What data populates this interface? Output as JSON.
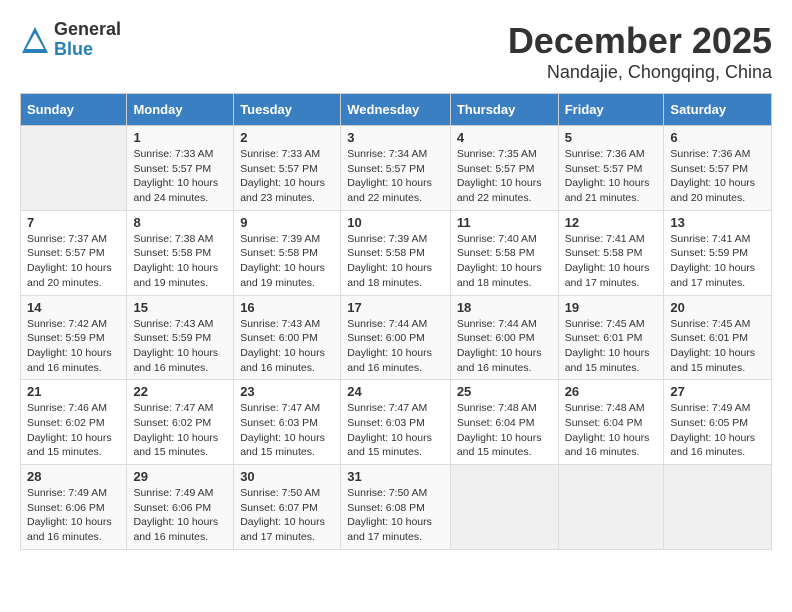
{
  "logo": {
    "general": "General",
    "blue": "Blue"
  },
  "title": "December 2025",
  "location": "Nandajie, Chongqing, China",
  "headers": [
    "Sunday",
    "Monday",
    "Tuesday",
    "Wednesday",
    "Thursday",
    "Friday",
    "Saturday"
  ],
  "weeks": [
    [
      {
        "day": "",
        "info": ""
      },
      {
        "day": "1",
        "info": "Sunrise: 7:33 AM\nSunset: 5:57 PM\nDaylight: 10 hours\nand 24 minutes."
      },
      {
        "day": "2",
        "info": "Sunrise: 7:33 AM\nSunset: 5:57 PM\nDaylight: 10 hours\nand 23 minutes."
      },
      {
        "day": "3",
        "info": "Sunrise: 7:34 AM\nSunset: 5:57 PM\nDaylight: 10 hours\nand 22 minutes."
      },
      {
        "day": "4",
        "info": "Sunrise: 7:35 AM\nSunset: 5:57 PM\nDaylight: 10 hours\nand 22 minutes."
      },
      {
        "day": "5",
        "info": "Sunrise: 7:36 AM\nSunset: 5:57 PM\nDaylight: 10 hours\nand 21 minutes."
      },
      {
        "day": "6",
        "info": "Sunrise: 7:36 AM\nSunset: 5:57 PM\nDaylight: 10 hours\nand 20 minutes."
      }
    ],
    [
      {
        "day": "7",
        "info": "Sunrise: 7:37 AM\nSunset: 5:57 PM\nDaylight: 10 hours\nand 20 minutes."
      },
      {
        "day": "8",
        "info": "Sunrise: 7:38 AM\nSunset: 5:58 PM\nDaylight: 10 hours\nand 19 minutes."
      },
      {
        "day": "9",
        "info": "Sunrise: 7:39 AM\nSunset: 5:58 PM\nDaylight: 10 hours\nand 19 minutes."
      },
      {
        "day": "10",
        "info": "Sunrise: 7:39 AM\nSunset: 5:58 PM\nDaylight: 10 hours\nand 18 minutes."
      },
      {
        "day": "11",
        "info": "Sunrise: 7:40 AM\nSunset: 5:58 PM\nDaylight: 10 hours\nand 18 minutes."
      },
      {
        "day": "12",
        "info": "Sunrise: 7:41 AM\nSunset: 5:58 PM\nDaylight: 10 hours\nand 17 minutes."
      },
      {
        "day": "13",
        "info": "Sunrise: 7:41 AM\nSunset: 5:59 PM\nDaylight: 10 hours\nand 17 minutes."
      }
    ],
    [
      {
        "day": "14",
        "info": "Sunrise: 7:42 AM\nSunset: 5:59 PM\nDaylight: 10 hours\nand 16 minutes."
      },
      {
        "day": "15",
        "info": "Sunrise: 7:43 AM\nSunset: 5:59 PM\nDaylight: 10 hours\nand 16 minutes."
      },
      {
        "day": "16",
        "info": "Sunrise: 7:43 AM\nSunset: 6:00 PM\nDaylight: 10 hours\nand 16 minutes."
      },
      {
        "day": "17",
        "info": "Sunrise: 7:44 AM\nSunset: 6:00 PM\nDaylight: 10 hours\nand 16 minutes."
      },
      {
        "day": "18",
        "info": "Sunrise: 7:44 AM\nSunset: 6:00 PM\nDaylight: 10 hours\nand 16 minutes."
      },
      {
        "day": "19",
        "info": "Sunrise: 7:45 AM\nSunset: 6:01 PM\nDaylight: 10 hours\nand 15 minutes."
      },
      {
        "day": "20",
        "info": "Sunrise: 7:45 AM\nSunset: 6:01 PM\nDaylight: 10 hours\nand 15 minutes."
      }
    ],
    [
      {
        "day": "21",
        "info": "Sunrise: 7:46 AM\nSunset: 6:02 PM\nDaylight: 10 hours\nand 15 minutes."
      },
      {
        "day": "22",
        "info": "Sunrise: 7:47 AM\nSunset: 6:02 PM\nDaylight: 10 hours\nand 15 minutes."
      },
      {
        "day": "23",
        "info": "Sunrise: 7:47 AM\nSunset: 6:03 PM\nDaylight: 10 hours\nand 15 minutes."
      },
      {
        "day": "24",
        "info": "Sunrise: 7:47 AM\nSunset: 6:03 PM\nDaylight: 10 hours\nand 15 minutes."
      },
      {
        "day": "25",
        "info": "Sunrise: 7:48 AM\nSunset: 6:04 PM\nDaylight: 10 hours\nand 15 minutes."
      },
      {
        "day": "26",
        "info": "Sunrise: 7:48 AM\nSunset: 6:04 PM\nDaylight: 10 hours\nand 16 minutes."
      },
      {
        "day": "27",
        "info": "Sunrise: 7:49 AM\nSunset: 6:05 PM\nDaylight: 10 hours\nand 16 minutes."
      }
    ],
    [
      {
        "day": "28",
        "info": "Sunrise: 7:49 AM\nSunset: 6:06 PM\nDaylight: 10 hours\nand 16 minutes."
      },
      {
        "day": "29",
        "info": "Sunrise: 7:49 AM\nSunset: 6:06 PM\nDaylight: 10 hours\nand 16 minutes."
      },
      {
        "day": "30",
        "info": "Sunrise: 7:50 AM\nSunset: 6:07 PM\nDaylight: 10 hours\nand 17 minutes."
      },
      {
        "day": "31",
        "info": "Sunrise: 7:50 AM\nSunset: 6:08 PM\nDaylight: 10 hours\nand 17 minutes."
      },
      {
        "day": "",
        "info": ""
      },
      {
        "day": "",
        "info": ""
      },
      {
        "day": "",
        "info": ""
      }
    ]
  ]
}
